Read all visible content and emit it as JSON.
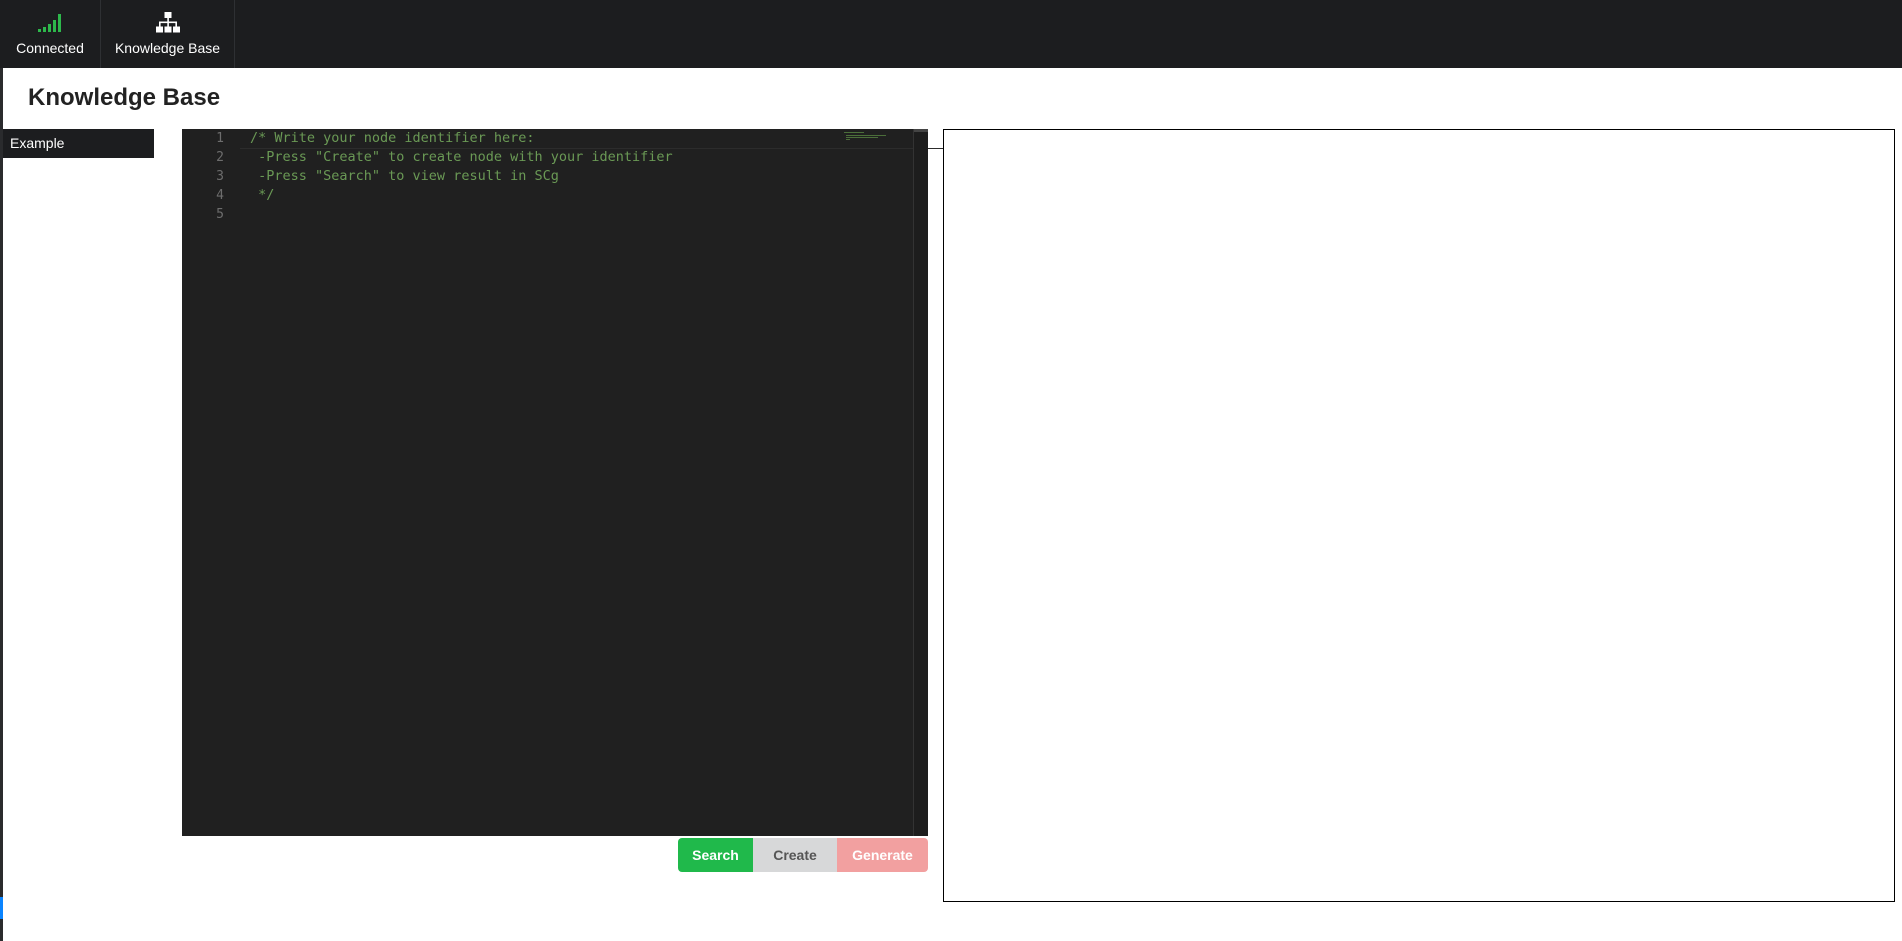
{
  "nav": {
    "connected_label": "Connected",
    "connected_icon": "signal-bars-icon",
    "connected_color": "#2db84b",
    "kb_label": "Knowledge Base",
    "kb_icon": "sitemap-icon"
  },
  "page": {
    "title": "Knowledge Base"
  },
  "examples": [
    {
      "label": "Example"
    }
  ],
  "editor": {
    "line_numbers": [
      "1",
      "2",
      "3",
      "4",
      "5"
    ],
    "lines": [
      "/* Write your node identifier here:",
      " -Press \"Create\" to create node with your identifier",
      " -Press \"Search\" to view result in SCg",
      " */",
      ""
    ]
  },
  "buttons": {
    "search": "Search",
    "create": "Create",
    "generate": "Generate"
  }
}
